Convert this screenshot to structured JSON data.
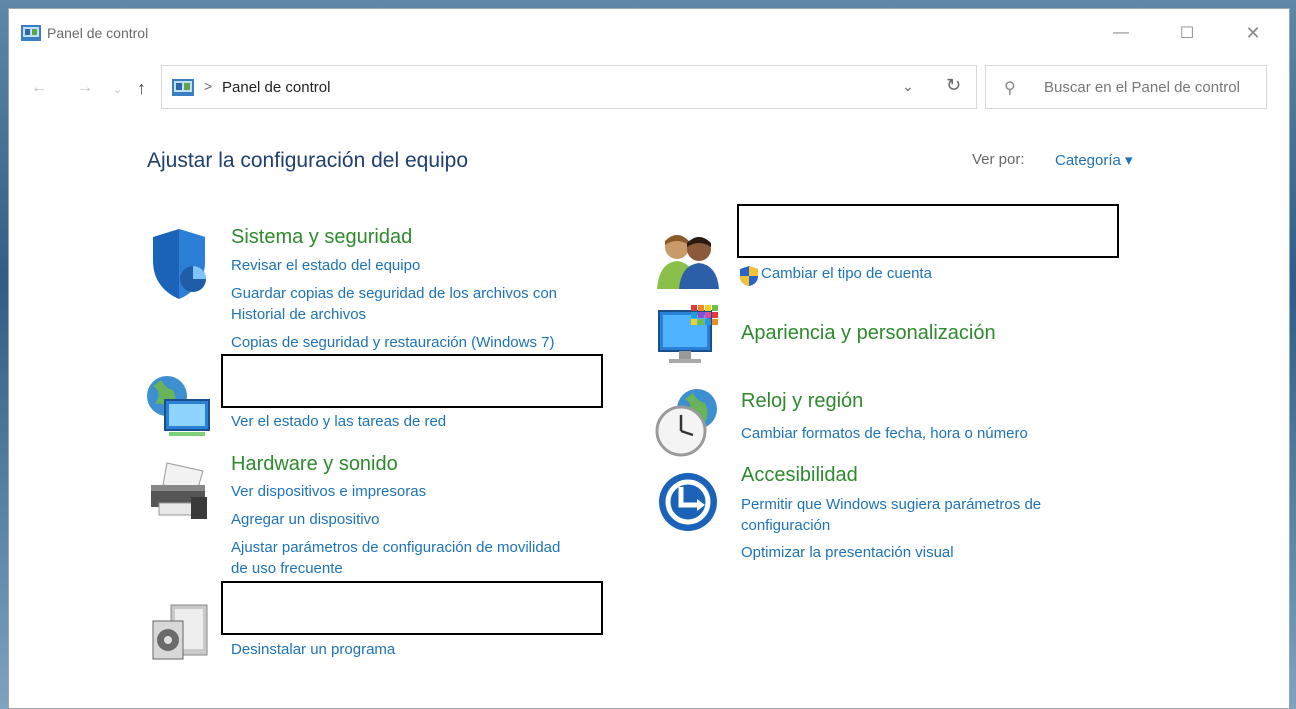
{
  "window": {
    "title": "Panel de control",
    "buttons": {
      "minimize": "—",
      "maximize": "☐",
      "close": "✕"
    }
  },
  "nav": {
    "back": "←",
    "forward": "→",
    "recent": "⌄",
    "up": "↑",
    "breadcrumb_sep": ">",
    "address": "Panel de control",
    "dropdown": "⌄",
    "refresh": "↻",
    "search_placeholder": "Buscar en el Panel de control",
    "search_icon": "⚲"
  },
  "main": {
    "heading": "Ajustar la configuración del equipo",
    "view_by_label": "Ver por:",
    "view_by_value": "Categoría ▾"
  },
  "categories": {
    "system": {
      "title": "Sistema y seguridad",
      "links": [
        "Revisar el estado del equipo",
        "Guardar copias de seguridad de los archivos con",
        "Historial de archivos",
        "Copias de seguridad y restauración (Windows 7)"
      ]
    },
    "network": {
      "links": [
        "Ver el estado y las tareas de red"
      ]
    },
    "hardware": {
      "title": "Hardware y sonido",
      "links": [
        "Ver dispositivos e impresoras",
        "Agregar un dispositivo",
        "Ajustar parámetros de configuración de movilidad",
        "de uso frecuente"
      ]
    },
    "programs": {
      "links": [
        "Desinstalar un programa"
      ]
    },
    "accounts": {
      "links": [
        "Cambiar el tipo de cuenta"
      ]
    },
    "appearance": {
      "title": "Apariencia y personalización"
    },
    "clock": {
      "title": "Reloj y región",
      "links": [
        "Cambiar formatos de fecha, hora o número"
      ]
    },
    "accessibility": {
      "title": "Accesibilidad",
      "links": [
        "Permitir que Windows sugiera parámetros de",
        "configuración",
        "Optimizar la presentación visual"
      ]
    }
  },
  "colors": {
    "link": "#1e73b8",
    "category_title": "#2e8a2e",
    "heading": "#1f3f6f"
  }
}
